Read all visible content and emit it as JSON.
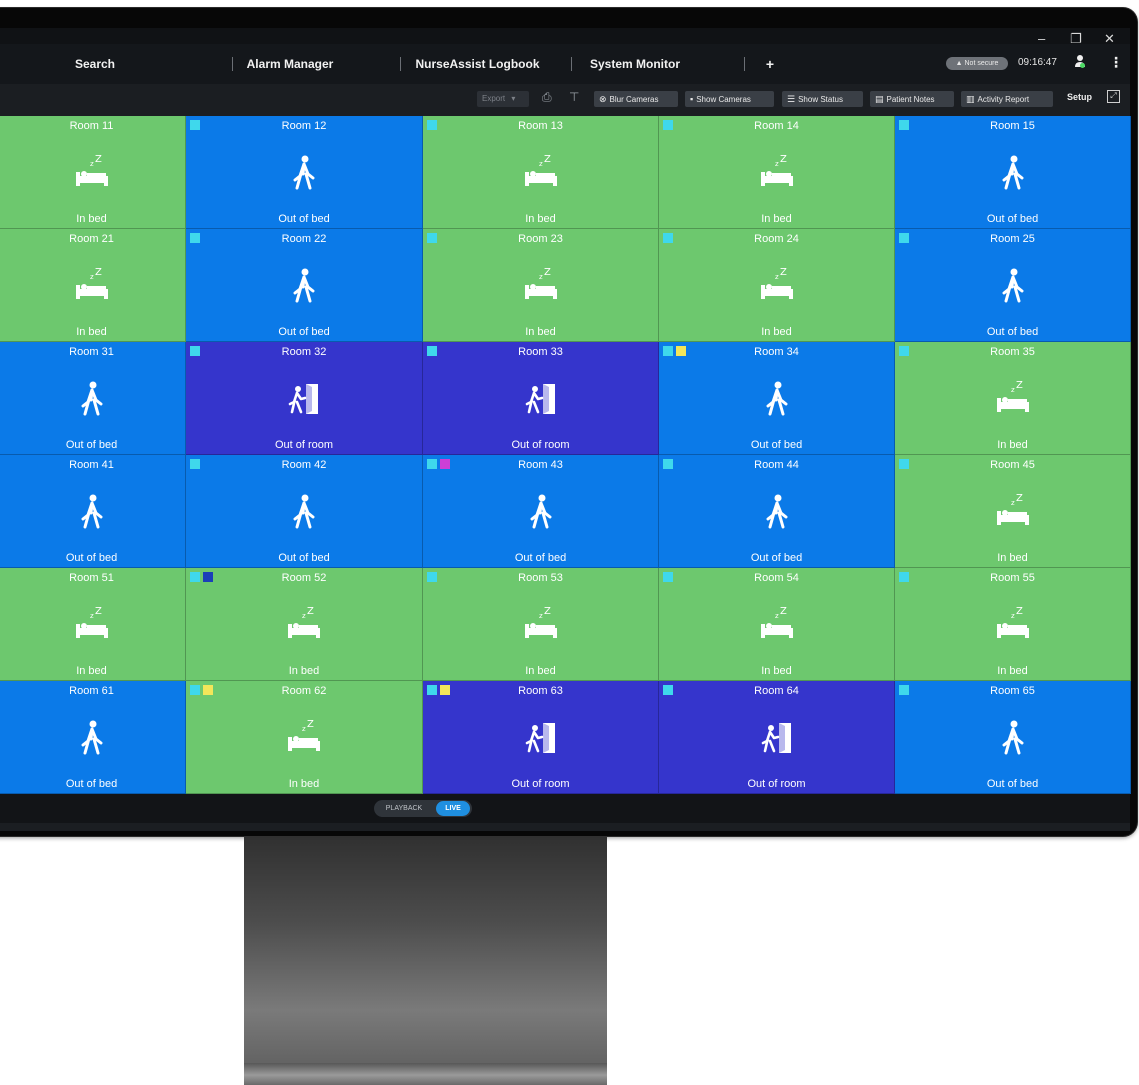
{
  "tabs": [
    {
      "label": "Search"
    },
    {
      "label": "Alarm Manager"
    },
    {
      "label": "NurseAssist Logbook"
    },
    {
      "label": "System Monitor"
    },
    {
      "label": "+"
    }
  ],
  "window_controls": {
    "minimize": "–",
    "restore": "❐",
    "close": "✕"
  },
  "header": {
    "security_badge": "▲ Not secure",
    "time": "09:16:47"
  },
  "toolbar": {
    "export_label": "Export",
    "blur_cameras": "Blur Cameras",
    "show_cameras": "Show Cameras",
    "show_status": "Show Status",
    "patient_notes": "Patient Notes",
    "activity_report": "Activity Report",
    "setup": "Setup"
  },
  "status_colors": {
    "in_bed": "#6dc86e",
    "out_of_bed": "#0b7ae8",
    "out_of_room": "#3535cc"
  },
  "flag_colors": {
    "cyan": "#3fd8ec",
    "yellow": "#f3e65a",
    "magenta": "#cc3fd6",
    "navy": "#1b3fb8"
  },
  "grid": [
    [
      {
        "name": "Room 11",
        "state": "in_bed",
        "status": "In bed",
        "icon": "bed-sleep-icon",
        "flags": []
      },
      {
        "name": "Room 12",
        "state": "out_of_bed",
        "status": "Out of bed",
        "icon": "walking-person-icon",
        "flags": [
          "cyan"
        ]
      },
      {
        "name": "Room 13",
        "state": "in_bed",
        "status": "In bed",
        "icon": "bed-sleep-icon",
        "flags": [
          "cyan"
        ]
      },
      {
        "name": "Room 14",
        "state": "in_bed",
        "status": "In bed",
        "icon": "bed-sleep-icon",
        "flags": [
          "cyan"
        ]
      },
      {
        "name": "Room 15",
        "state": "out_of_bed",
        "status": "Out of bed",
        "icon": "walking-person-icon",
        "flags": [
          "cyan"
        ]
      }
    ],
    [
      {
        "name": "Room 21",
        "state": "in_bed",
        "status": "In bed",
        "icon": "bed-sleep-icon",
        "flags": []
      },
      {
        "name": "Room 22",
        "state": "out_of_bed",
        "status": "Out of bed",
        "icon": "walking-person-icon",
        "flags": [
          "cyan"
        ]
      },
      {
        "name": "Room 23",
        "state": "in_bed",
        "status": "In bed",
        "icon": "bed-sleep-icon",
        "flags": [
          "cyan"
        ]
      },
      {
        "name": "Room 24",
        "state": "in_bed",
        "status": "In bed",
        "icon": "bed-sleep-icon",
        "flags": [
          "cyan"
        ]
      },
      {
        "name": "Room 25",
        "state": "out_of_bed",
        "status": "Out of bed",
        "icon": "walking-person-icon",
        "flags": [
          "cyan"
        ]
      }
    ],
    [
      {
        "name": "Room 31",
        "state": "out_of_bed",
        "status": "Out of bed",
        "icon": "walking-person-icon",
        "flags": []
      },
      {
        "name": "Room 32",
        "state": "out_of_room",
        "status": "Out of room",
        "icon": "exit-door-icon",
        "flags": [
          "cyan"
        ]
      },
      {
        "name": "Room 33",
        "state": "out_of_room",
        "status": "Out of room",
        "icon": "exit-door-icon",
        "flags": [
          "cyan"
        ]
      },
      {
        "name": "Room 34",
        "state": "out_of_bed",
        "status": "Out of bed",
        "icon": "walking-person-icon",
        "flags": [
          "cyan",
          "yellow"
        ]
      },
      {
        "name": "Room 35",
        "state": "in_bed",
        "status": "In bed",
        "icon": "bed-sleep-icon",
        "flags": [
          "cyan"
        ]
      }
    ],
    [
      {
        "name": "Room 41",
        "state": "out_of_bed",
        "status": "Out of bed",
        "icon": "walking-person-icon",
        "flags": []
      },
      {
        "name": "Room 42",
        "state": "out_of_bed",
        "status": "Out of bed",
        "icon": "walking-person-icon",
        "flags": [
          "cyan"
        ]
      },
      {
        "name": "Room 43",
        "state": "out_of_bed",
        "status": "Out of bed",
        "icon": "walking-person-icon",
        "flags": [
          "cyan",
          "magenta"
        ]
      },
      {
        "name": "Room 44",
        "state": "out_of_bed",
        "status": "Out of bed",
        "icon": "walking-person-icon",
        "flags": [
          "cyan"
        ]
      },
      {
        "name": "Room 45",
        "state": "in_bed",
        "status": "In bed",
        "icon": "bed-sleep-icon",
        "flags": [
          "cyan"
        ]
      }
    ],
    [
      {
        "name": "Room 51",
        "state": "in_bed",
        "status": "In bed",
        "icon": "bed-sleep-icon",
        "flags": []
      },
      {
        "name": "Room 52",
        "state": "in_bed",
        "status": "In bed",
        "icon": "bed-sleep-icon",
        "flags": [
          "cyan",
          "navy"
        ]
      },
      {
        "name": "Room 53",
        "state": "in_bed",
        "status": "In bed",
        "icon": "bed-sleep-icon",
        "flags": [
          "cyan"
        ]
      },
      {
        "name": "Room 54",
        "state": "in_bed",
        "status": "In bed",
        "icon": "bed-sleep-icon",
        "flags": [
          "cyan"
        ]
      },
      {
        "name": "Room 55",
        "state": "in_bed",
        "status": "In bed",
        "icon": "bed-sleep-icon",
        "flags": [
          "cyan"
        ]
      }
    ],
    [
      {
        "name": "Room 61",
        "state": "out_of_bed",
        "status": "Out of bed",
        "icon": "walking-person-icon",
        "flags": []
      },
      {
        "name": "Room 62",
        "state": "in_bed",
        "status": "In bed",
        "icon": "bed-sleep-icon",
        "flags": [
          "cyan",
          "yellow"
        ]
      },
      {
        "name": "Room 63",
        "state": "out_of_room",
        "status": "Out of room",
        "icon": "exit-door-icon",
        "flags": [
          "cyan",
          "yellow"
        ]
      },
      {
        "name": "Room 64",
        "state": "out_of_room",
        "status": "Out of room",
        "icon": "exit-door-icon",
        "flags": [
          "cyan"
        ]
      },
      {
        "name": "Room 65",
        "state": "out_of_bed",
        "status": "Out of bed",
        "icon": "walking-person-icon",
        "flags": [
          "cyan"
        ]
      }
    ]
  ],
  "bottombar": {
    "playback": "PLAYBACK",
    "live": "LIVE"
  }
}
